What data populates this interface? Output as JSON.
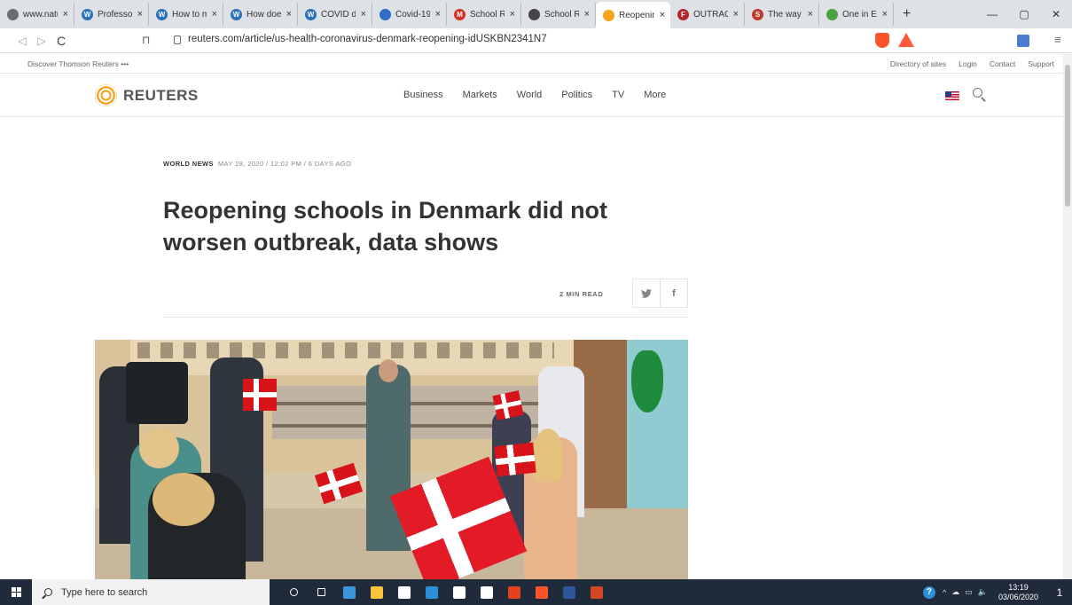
{
  "browser": {
    "tabs": [
      {
        "title": "www.natu",
        "favicon_color": "#6d6d6d",
        "favicon_glyph": ""
      },
      {
        "title": "Professor",
        "favicon_color": "#2a73b8",
        "favicon_glyph": "W"
      },
      {
        "title": "How to m",
        "favicon_color": "#2a73b8",
        "favicon_glyph": "W"
      },
      {
        "title": "How does",
        "favicon_color": "#2a73b8",
        "favicon_glyph": "W"
      },
      {
        "title": "COVID de",
        "favicon_color": "#2a73b8",
        "favicon_glyph": "W"
      },
      {
        "title": "Covid-19",
        "favicon_color": "#2e6fc4",
        "favicon_glyph": ""
      },
      {
        "title": "School Re",
        "favicon_color": "#d93025",
        "favicon_glyph": "M"
      },
      {
        "title": "School Re",
        "favicon_color": "#444444",
        "favicon_glyph": ""
      },
      {
        "title": "Reopenin",
        "favicon_color": "#f7a21b",
        "favicon_glyph": "",
        "active": true
      },
      {
        "title": "OUTRAGE",
        "favicon_color": "#b3262b",
        "favicon_glyph": "F"
      },
      {
        "title": "The way",
        "favicon_color": "#c0392b",
        "favicon_glyph": "S"
      },
      {
        "title": "One in Ev",
        "favicon_color": "#48a23f",
        "favicon_glyph": ""
      }
    ],
    "new_tab": "+",
    "tab_close": "×",
    "window_controls": {
      "minimize": "—",
      "maximize": "▢",
      "close": "✕"
    },
    "nav": {
      "back": "◁",
      "forward": "▷",
      "reload": "C",
      "bookmark": "⊓",
      "menu": "≡"
    },
    "url": "reuters.com/article/us-health-coronavirus-denmark-reopening-idUSKBN2341N7"
  },
  "site": {
    "discover": "Discover Thomson Reuters",
    "discover_more": "•••",
    "utility_links": [
      "Directory of sites",
      "Login",
      "Contact",
      "Support"
    ],
    "logo_text": "REUTERS",
    "nav_items": [
      "Business",
      "Markets",
      "World",
      "Politics",
      "TV",
      "More"
    ]
  },
  "article": {
    "section": "WORLD NEWS",
    "dateline": "MAY 28, 2020 / 12:02 PM / 6 DAYS AGO",
    "headline": "Reopening schools in Denmark did not worsen outbreak, data shows",
    "read_time": "2 MIN READ",
    "share_twitter": "🐦",
    "share_facebook": "f"
  },
  "taskbar": {
    "search_placeholder": "Type here to search",
    "time": "13:19",
    "date": "03/06/2020",
    "notification_count": "1",
    "apps": [
      {
        "name": "cortana",
        "color": "#ffffff"
      },
      {
        "name": "task-view",
        "color": "#ffffff"
      },
      {
        "name": "edge",
        "color": "#3a96dd"
      },
      {
        "name": "file-explorer",
        "color": "#f8c43c"
      },
      {
        "name": "store",
        "color": "#ffffff"
      },
      {
        "name": "mail",
        "color": "#2d8fd5"
      },
      {
        "name": "dropbox",
        "color": "#ffffff"
      },
      {
        "name": "winamp",
        "color": "#ffffff"
      },
      {
        "name": "office",
        "color": "#e2431d"
      },
      {
        "name": "brave",
        "color": "#fb542b"
      },
      {
        "name": "word",
        "color": "#2b579a"
      },
      {
        "name": "powerpoint",
        "color": "#d24726"
      }
    ],
    "tray_chevron": "^",
    "tray_volume": "🔈"
  }
}
